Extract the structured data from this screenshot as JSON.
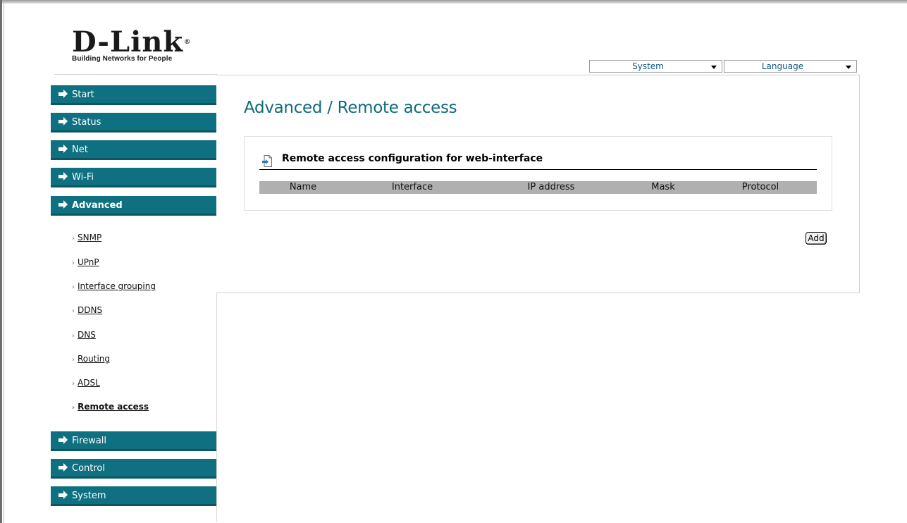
{
  "logo": {
    "brand": "D-Link",
    "reg": "®",
    "tagline": "Building Networks for People"
  },
  "top_selects": {
    "system": "System",
    "language": "Language"
  },
  "sidebar": {
    "start": "Start",
    "status": "Status",
    "net": "Net",
    "wifi": "Wi-Fi",
    "advanced": "Advanced",
    "sub_items": [
      "SNMP",
      "UPnP",
      "Interface grouping",
      "DDNS",
      "DNS",
      "Routing",
      "ADSL",
      "Remote access"
    ],
    "firewall": "Firewall",
    "control": "Control",
    "system": "System"
  },
  "page_title": "Advanced / Remote access",
  "section": {
    "title": "Remote access configuration for web-interface",
    "columns": [
      "Name",
      "Interface",
      "IP address",
      "Mask",
      "Protocol"
    ]
  },
  "add_button": "Add",
  "colors": {
    "accent": "#0e7080",
    "title": "#0f6c7a",
    "header_bg": "#b0b0b0"
  }
}
